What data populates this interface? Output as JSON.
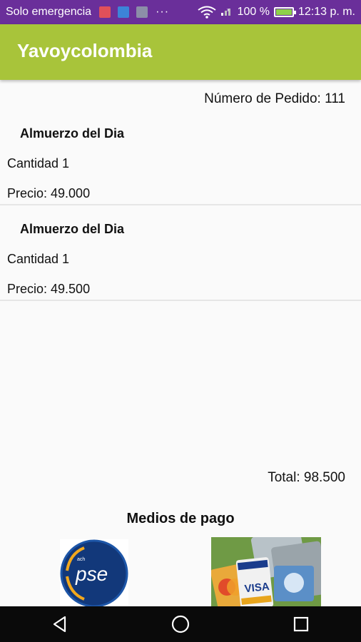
{
  "status_bar": {
    "carrier": "Solo emergencia",
    "dots": "···",
    "battery_percent": "100 %",
    "time": "12:13 p. m."
  },
  "app_bar": {
    "title": "Yavoycolombia"
  },
  "order": {
    "number_label": "Número de Pedido: 111",
    "items": [
      {
        "name": "Almuerzo del Dia",
        "quantity": "Cantidad 1",
        "price": "Precio: 49.000"
      },
      {
        "name": "Almuerzo del Dia",
        "quantity": "Cantidad 1",
        "price": "Precio: 49.500"
      }
    ],
    "total": "Total:  98.500"
  },
  "payment": {
    "title": "Medios de pago",
    "methods": [
      {
        "logo_text": "pse",
        "logo_small": "ach"
      },
      {
        "logo_text": "VISA"
      }
    ]
  },
  "colors": {
    "status_bar": "#6a2f9a",
    "app_bar": "#a8c43a",
    "nav_bar": "#0a0a0a"
  }
}
